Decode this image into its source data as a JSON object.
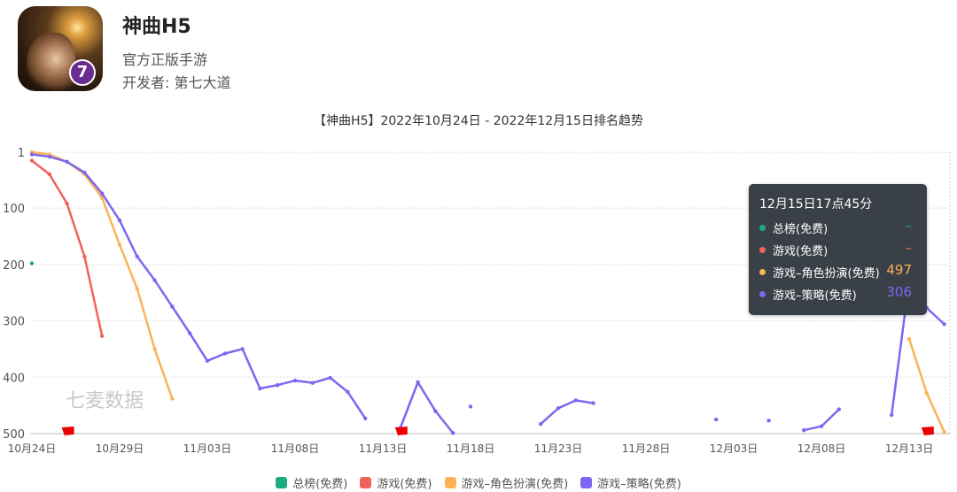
{
  "app": {
    "name": "神曲H5",
    "tagline": "官方正版手游",
    "developer": "开发者: 第七大道",
    "icon_badge": "7"
  },
  "watermark": "七麦数据",
  "tooltip": {
    "time": "12月15日17点45分",
    "rows": [
      {
        "name": "总榜(免费)",
        "value": "–",
        "color": "#1aab84"
      },
      {
        "name": "游戏(免费)",
        "value": "–",
        "color": "#f0635a"
      },
      {
        "name": "游戏–角色扮演(免费)",
        "value": "497",
        "color": "#fbb355"
      },
      {
        "name": "游戏–策略(免费)",
        "value": "306",
        "color": "#7c68f0"
      }
    ]
  },
  "chart_data": {
    "type": "line",
    "title": "【神曲H5】2022年10月24日 - 2022年12月15日排名趋势",
    "y_inverted": true,
    "ylim": [
      1,
      500
    ],
    "y_ticks": [
      "1",
      "100",
      "200",
      "300",
      "400",
      "500"
    ],
    "x_range": [
      "2022-10-24",
      "2022-12-15"
    ],
    "x_ticks": [
      "10月24日",
      "10月29日",
      "11月03日",
      "11月08日",
      "11月13日",
      "11月18日",
      "11月23日",
      "11月28日",
      "12月03日",
      "12月08日",
      "12月13日"
    ],
    "grid": true,
    "legend": "bottom",
    "flags": [
      "2022-10-26",
      "2022-11-14",
      "2022-12-14"
    ],
    "series": [
      {
        "name": "总榜(免费)",
        "color": "#1aab84",
        "points": [
          [
            "2022-10-24",
            198
          ]
        ]
      },
      {
        "name": "游戏(免费)",
        "color": "#f0635a",
        "points": [
          [
            "2022-10-24",
            16
          ],
          [
            "2022-10-25",
            40
          ],
          [
            "2022-10-26",
            92
          ],
          [
            "2022-10-27",
            186
          ],
          [
            "2022-10-28",
            327
          ]
        ]
      },
      {
        "name": "游戏–角色扮演(免费)",
        "color": "#fbb355",
        "points": [
          [
            "2022-10-24",
            1
          ],
          [
            "2022-10-25",
            5
          ],
          [
            "2022-10-26",
            18
          ],
          [
            "2022-10-27",
            40
          ],
          [
            "2022-10-28",
            82
          ],
          [
            "2022-10-29",
            165
          ],
          [
            "2022-10-30",
            243
          ],
          [
            "2022-10-31",
            350
          ],
          [
            "2022-11-01",
            438
          ],
          null,
          [
            "2022-12-13",
            332
          ],
          [
            "2022-12-14",
            428
          ],
          [
            "2022-12-15",
            497
          ]
        ]
      },
      {
        "name": "游戏–策略(免费)",
        "color": "#7c68f0",
        "points": [
          [
            "2022-10-24",
            5
          ],
          [
            "2022-10-25",
            9
          ],
          [
            "2022-10-26",
            18
          ],
          [
            "2022-10-27",
            37
          ],
          [
            "2022-10-28",
            74
          ],
          [
            "2022-10-29",
            122
          ],
          [
            "2022-10-30",
            186
          ],
          [
            "2022-10-31",
            228
          ],
          [
            "2022-11-01",
            275
          ],
          [
            "2022-11-02",
            322
          ],
          [
            "2022-11-03",
            371
          ],
          [
            "2022-11-04",
            358
          ],
          [
            "2022-11-05",
            350
          ],
          [
            "2022-11-06",
            420
          ],
          [
            "2022-11-07",
            414
          ],
          [
            "2022-11-08",
            406
          ],
          [
            "2022-11-09",
            410
          ],
          [
            "2022-11-10",
            401
          ],
          [
            "2022-11-11",
            426
          ],
          [
            "2022-11-12",
            473
          ],
          null,
          [
            "2022-11-14",
            490
          ],
          [
            "2022-11-15",
            409
          ],
          [
            "2022-11-16",
            460
          ],
          [
            "2022-11-17",
            499
          ],
          null,
          [
            "2022-11-18",
            452
          ],
          null,
          [
            "2022-11-22",
            483
          ],
          [
            "2022-11-23",
            455
          ],
          [
            "2022-11-24",
            441
          ],
          [
            "2022-11-25",
            446
          ],
          null,
          [
            "2022-12-02",
            475
          ],
          null,
          [
            "2022-12-05",
            477
          ],
          null,
          [
            "2022-12-07",
            494
          ],
          [
            "2022-12-08",
            487
          ],
          [
            "2022-12-09",
            457
          ],
          null,
          [
            "2022-12-12",
            467
          ],
          [
            "2022-12-13",
            230
          ],
          [
            "2022-12-14",
            277
          ],
          [
            "2022-12-15",
            306
          ]
        ]
      }
    ]
  }
}
